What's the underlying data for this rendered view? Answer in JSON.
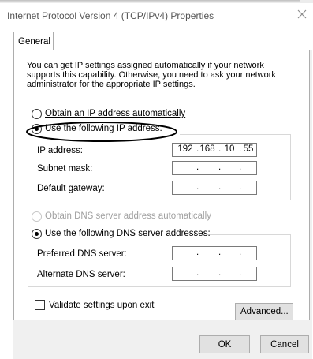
{
  "window": {
    "title": "Internet Protocol Version 4 (TCP/IPv4) Properties",
    "close_icon": "close-icon"
  },
  "tabs": [
    {
      "label": "General",
      "selected": true
    }
  ],
  "description": "You can get IP settings assigned automatically if your network supports this capability. Otherwise, you need to ask your network administrator for the appropriate IP settings.",
  "ip_settings": {
    "obtain_auto_label": "Obtain an IP address automatically",
    "use_following_label": "Use the following IP address:",
    "selected": "use_following",
    "fields": [
      {
        "label": "IP address:",
        "octets": [
          "192",
          "168",
          "10",
          "55"
        ]
      },
      {
        "label": "Subnet mask:",
        "octets": [
          "",
          "",
          "",
          ""
        ]
      },
      {
        "label": "Default gateway:",
        "octets": [
          "",
          "",
          "",
          ""
        ]
      }
    ]
  },
  "dns_settings": {
    "obtain_auto_label": "Obtain DNS server address automatically",
    "obtain_auto_disabled": true,
    "use_following_label": "Use the following DNS server addresses:",
    "selected": "use_following",
    "fields": [
      {
        "label": "Preferred DNS server:",
        "octets": [
          "",
          "",
          "",
          ""
        ]
      },
      {
        "label": "Alternate DNS server:",
        "octets": [
          "",
          "",
          "",
          ""
        ]
      }
    ]
  },
  "validate": {
    "label": "Validate settings upon exit",
    "checked": false
  },
  "buttons": {
    "advanced": "Advanced...",
    "ok": "OK",
    "cancel": "Cancel"
  },
  "colors": {
    "annotation_ellipse": "#000000",
    "disabled_text": "#a0a0a0",
    "button_face": "#e1e1e1"
  }
}
